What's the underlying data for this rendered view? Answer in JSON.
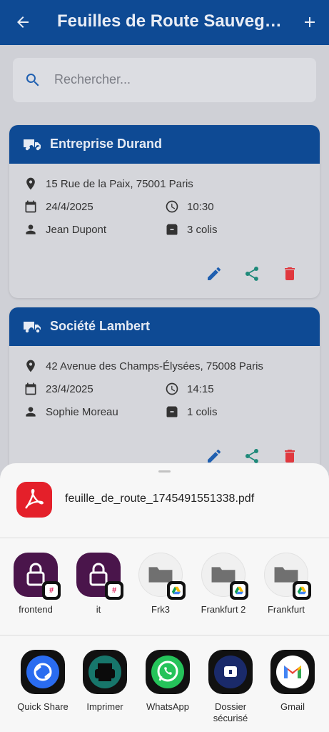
{
  "app_bar": {
    "title": "Feuilles de Route Sauvegardées"
  },
  "search": {
    "placeholder": "Rechercher..."
  },
  "cards": [
    {
      "company": "Entreprise Durand",
      "address": "15 Rue de la Paix, 75001 Paris",
      "date": "24/4/2025",
      "time": "10:30",
      "contact": "Jean Dupont",
      "parcels": "3 colis"
    },
    {
      "company": "Société Lambert",
      "address": "42 Avenue des Champs-Élysées, 75008 Paris",
      "date": "23/4/2025",
      "time": "14:15",
      "contact": "Sophie Moreau",
      "parcels": "1 colis"
    }
  ],
  "share_sheet": {
    "file_name": "feuille_de_route_1745491551338.pdf",
    "direct_targets": [
      {
        "label": "frontend",
        "icon": "slack-lock-icon"
      },
      {
        "label": "it",
        "icon": "slack-lock-icon"
      },
      {
        "label": "Frk3",
        "icon": "drive-folder-icon"
      },
      {
        "label": "Frankfurt 2",
        "icon": "drive-folder-icon"
      },
      {
        "label": "Frankfurt",
        "icon": "drive-folder-icon"
      }
    ],
    "apps": [
      {
        "label": "Quick Share",
        "icon": "quick-share-icon"
      },
      {
        "label": "Imprimer",
        "icon": "printer-icon"
      },
      {
        "label": "WhatsApp",
        "icon": "whatsapp-icon"
      },
      {
        "label": "Dossier sécurisé",
        "icon": "secure-folder-icon"
      },
      {
        "label": "Gmail",
        "icon": "gmail-icon"
      }
    ]
  },
  "colors": {
    "primary": "#0e4a94",
    "edit": "#1f5fb0",
    "share": "#1f8a7a",
    "delete": "#e0383e",
    "slack_purple": "#4a154b"
  }
}
